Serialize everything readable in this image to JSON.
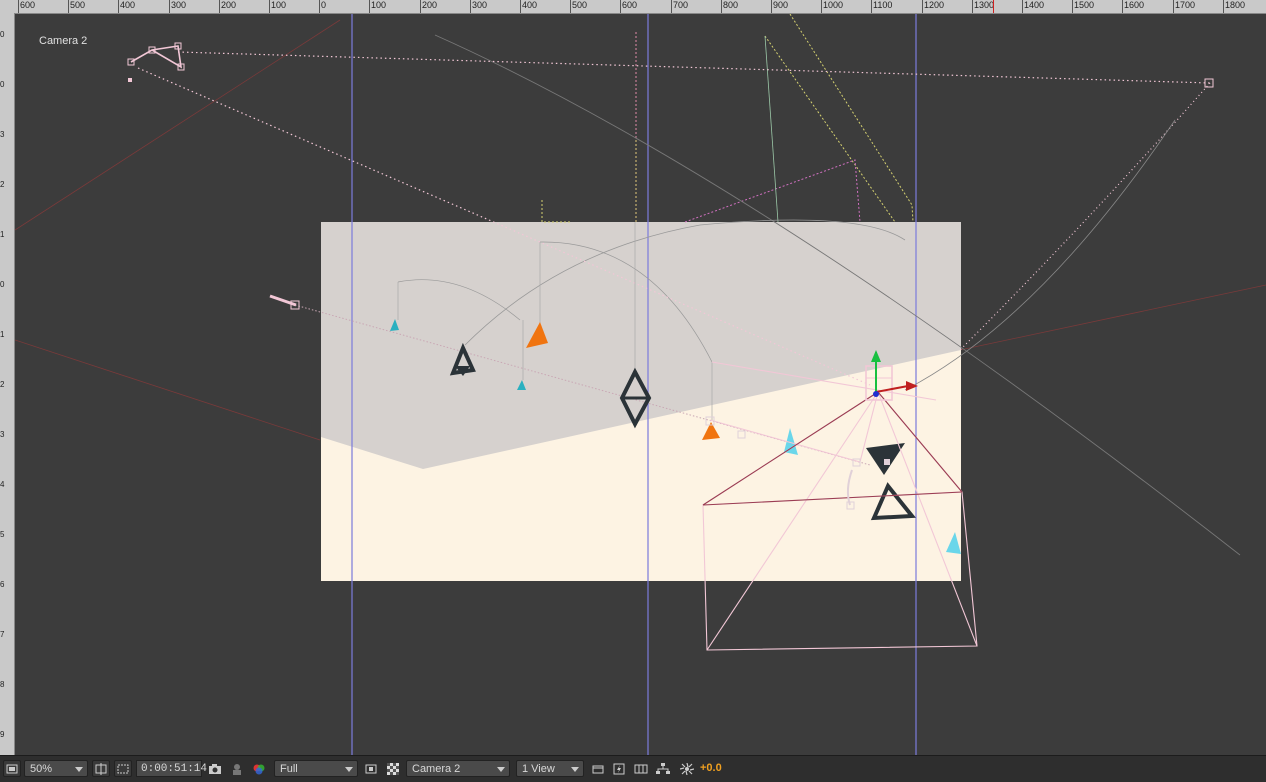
{
  "view": {
    "label": "Camera 2"
  },
  "rulers": {
    "top_labels": [
      "600",
      "500",
      "400",
      "300",
      "200",
      "100",
      "0",
      "100",
      "200",
      "300",
      "400",
      "500",
      "600",
      "700",
      "800",
      "900",
      "1000",
      "1100",
      "1200",
      "1300",
      "1400",
      "1500",
      "1600",
      "1700",
      "1800"
    ],
    "left_labels": [
      "0",
      "0",
      "3",
      "2",
      "1",
      "0",
      "1",
      "2",
      "3",
      "4",
      "5",
      "6",
      "7",
      "8",
      "9"
    ]
  },
  "toolbar": {
    "magnification": "50%",
    "timecode": "0:00:51:14",
    "resolution": "Full",
    "active_camera": "Camera 2",
    "view_layout": "1 View",
    "exposure": "+0.0"
  },
  "icons": {
    "magnification": "magnification-ratio-icon",
    "title_safe": "title-action-safe-icon",
    "mask_visibility": "mask-visibility-icon",
    "snapshot": "camera-snapshot-icon",
    "show_snapshot": "show-snapshot-icon",
    "channels": "rgb-channels-icon",
    "roi": "region-of-interest-icon",
    "transparency_grid": "transparency-grid-icon",
    "toggle_pixel_aspect": "pixel-aspect-icon",
    "fast_previews": "fast-previews-icon",
    "timeline": "timeline-icon",
    "flowchart": "flowchart-icon",
    "exposure_reset": "reset-exposure-icon"
  },
  "colors": {
    "background": "#3c3c3c",
    "comp_wall": "#d6d1ce",
    "comp_floor": "#fdf3e3",
    "guide": "#7b7bdc",
    "motion_path": "#f2c7d6",
    "orange": "#f07410",
    "cyan": "#3ec8dc",
    "dark_shape": "#2b3338",
    "exposure_text": "#f0a020"
  }
}
